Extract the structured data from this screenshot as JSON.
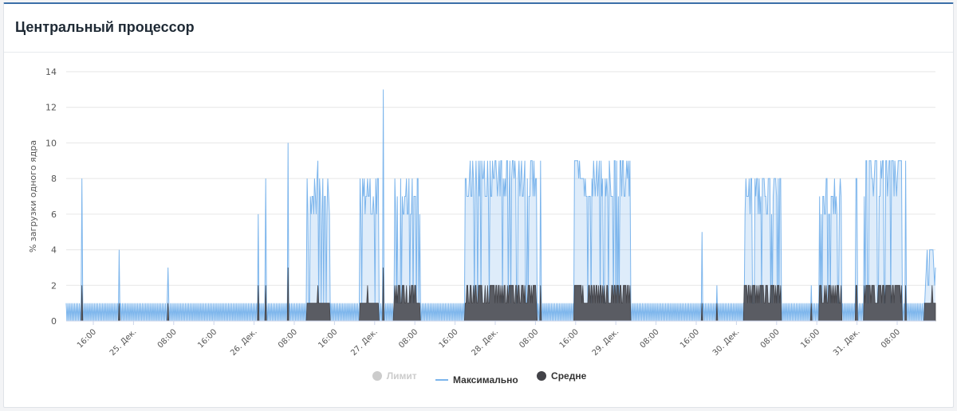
{
  "panel": {
    "title": "Центральный процессор"
  },
  "colors": {
    "max": "#7cb5ec",
    "avg": "#434348",
    "limit": "#cccccc",
    "grid": "#e6e6e6"
  },
  "chart_data": {
    "type": "area",
    "ylabel": "% загрузки одного ядра",
    "ylim": [
      0,
      14
    ],
    "y_ticks": [
      0,
      2,
      4,
      6,
      8,
      10,
      12,
      14
    ],
    "x_ticks": [
      "16:00",
      "25. Дек.",
      "08:00",
      "16:00",
      "26. Дек.",
      "08:00",
      "16:00",
      "27. Дек.",
      "08:00",
      "16:00",
      "28. Дек.",
      "08:00",
      "16:00",
      "29. Дек.",
      "08:00",
      "16:00",
      "30. Дек.",
      "08:00",
      "16:00",
      "31. Дек.",
      "08:00"
    ],
    "legend": [
      {
        "name": "Лимит",
        "enabled": false
      },
      {
        "name": "Максимально",
        "enabled": true
      },
      {
        "name": "Средне",
        "enabled": true
      }
    ],
    "peaks_max": [
      {
        "x": 4.1,
        "y": 8
      },
      {
        "x": 14.1,
        "y": 4
      },
      {
        "x": 27.0,
        "y": 3
      },
      {
        "x": 51.0,
        "y": 6
      },
      {
        "x": 53.1,
        "y": 8
      },
      {
        "x": 59.0,
        "y": 10
      },
      {
        "x": 66.8,
        "y": 9
      },
      {
        "x": 80.0,
        "y": 8
      },
      {
        "x": 84.3,
        "y": 13
      },
      {
        "x": 90.5,
        "y": 8
      },
      {
        "x": 110.0,
        "y": 9
      },
      {
        "x": 126.0,
        "y": 9
      },
      {
        "x": 141.0,
        "y": 9
      },
      {
        "x": 148.0,
        "y": 9
      },
      {
        "x": 169.0,
        "y": 5
      },
      {
        "x": 173.0,
        "y": 2
      },
      {
        "x": 182.0,
        "y": 8
      },
      {
        "x": 198.0,
        "y": 2
      },
      {
        "x": 202.0,
        "y": 8
      },
      {
        "x": 210.0,
        "y": 8
      },
      {
        "x": 218.0,
        "y": 9
      },
      {
        "x": 223.0,
        "y": 9
      },
      {
        "x": 230.0,
        "y": 4
      }
    ],
    "busy_periods": [
      {
        "start": 64,
        "end": 70,
        "max": 8,
        "avg": 1
      },
      {
        "start": 78,
        "end": 83,
        "max": 8,
        "avg": 1
      },
      {
        "start": 87,
        "end": 94,
        "max": 8,
        "avg": 2
      },
      {
        "start": 106,
        "end": 125,
        "max": 9,
        "avg": 2
      },
      {
        "start": 135,
        "end": 150,
        "max": 9,
        "avg": 2
      },
      {
        "start": 180,
        "end": 190,
        "max": 8,
        "avg": 2
      },
      {
        "start": 200,
        "end": 206,
        "max": 8,
        "avg": 2
      },
      {
        "start": 212,
        "end": 222,
        "max": 9,
        "avg": 2
      },
      {
        "start": 228,
        "end": 231,
        "max": 4,
        "avg": 1
      }
    ],
    "baseline_max": 1,
    "baseline_avg": 0,
    "x_range": [
      0,
      231
    ]
  }
}
